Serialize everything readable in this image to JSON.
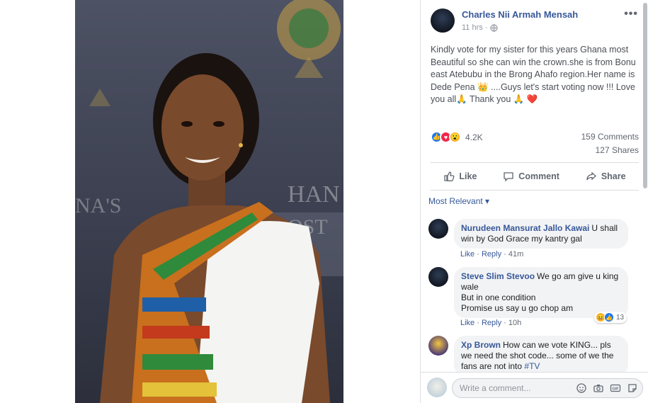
{
  "post": {
    "author": "Charles Nii Armah Mensah",
    "time": "11 hrs ·",
    "text": "Kindly vote for my sister for this years Ghana most Beautiful so she can win the crown.she is from Bonu east Atebubu in the Brong Ahafo region.Her name is Dede Pena 👑 ....Guys let's start voting now !!! Love you all🙏 Thank you 🙏 ❤️",
    "reaction_count": "4.2K",
    "comments_count": "159 Comments",
    "shares_count": "127 Shares"
  },
  "actions": {
    "like": "Like",
    "comment": "Comment",
    "share": "Share"
  },
  "filter": "Most Relevant ▾",
  "comments": [
    {
      "name": "Nurudeen Mansurat Jallo Kawai",
      "text": "U shall win by God Grace my kantry gal",
      "like": "Like",
      "reply": "Reply",
      "time": "41m",
      "sep": "·"
    },
    {
      "name": "Steve Slim Stevoo",
      "line1": "We go am give u king wale",
      "line2": "But in one condition",
      "line3": "Promise us say u go chop am",
      "like": "Like",
      "reply": "Reply",
      "time": "10h",
      "sep": "·",
      "reaction_count": "13"
    },
    {
      "name": "Xp Brown",
      "text": "How can we vote KING... pls we need the shot code... some of we the fans are not into",
      "tag": "#TV"
    }
  ],
  "compose": {
    "placeholder": "Write a comment..."
  },
  "colors": {
    "link": "#365899",
    "accent_blue": "#1877f2",
    "love": "#f0284a",
    "wow": "#f7b125"
  },
  "icons": [
    "globe-icon",
    "more-icon",
    "like-icon",
    "comment-icon",
    "share-icon",
    "emoji-icon",
    "camera-icon",
    "gif-icon",
    "sticker-icon"
  ]
}
